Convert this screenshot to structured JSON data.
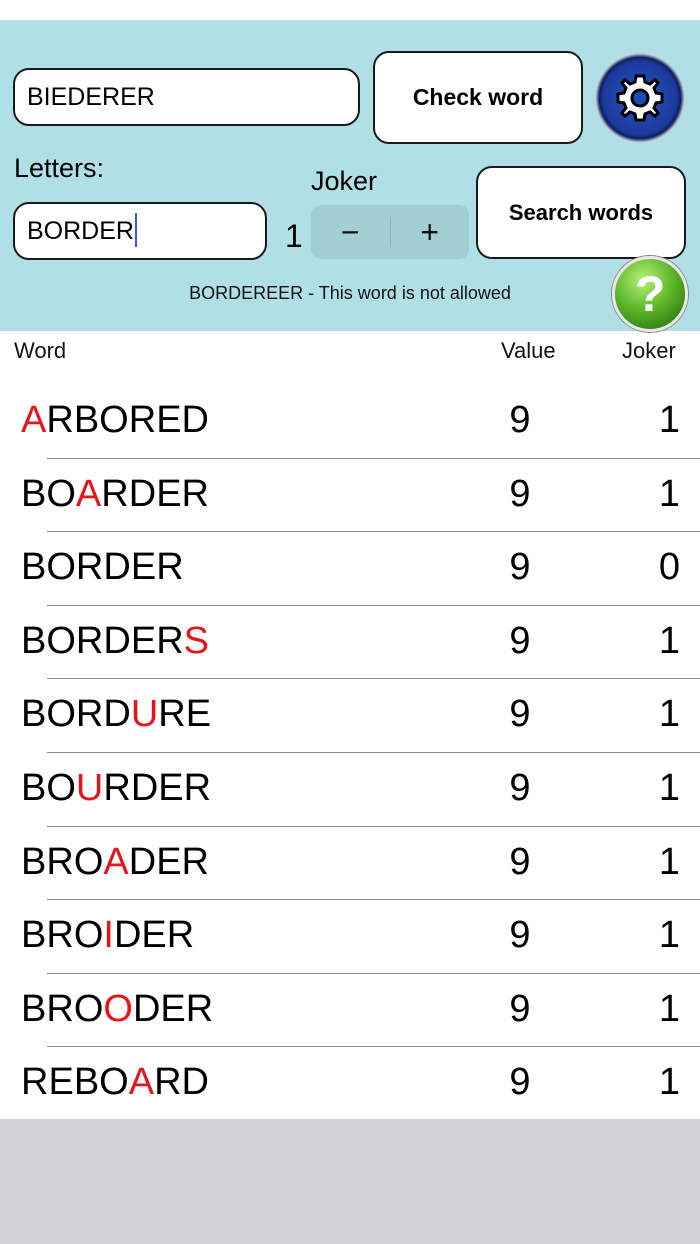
{
  "form": {
    "word_value": "BIEDERER",
    "check_label": "Check word",
    "letters_label": "Letters:",
    "letters_value": "BORDER",
    "joker_label": "Joker",
    "joker_count": "1",
    "minus": "−",
    "plus": "+",
    "search_label": "Search words",
    "status": "BORDEREER - This word is not allowed",
    "help": "?"
  },
  "table": {
    "headers": {
      "word": "Word",
      "value": "Value",
      "joker": "Joker"
    },
    "highlight_color": "#e8141b",
    "rows": [
      {
        "word": "ARBORED",
        "hl": [
          0
        ],
        "value": "9",
        "joker": "1"
      },
      {
        "word": "BOARDER",
        "hl": [
          2
        ],
        "value": "9",
        "joker": "1"
      },
      {
        "word": "BORDER",
        "hl": [],
        "value": "9",
        "joker": "0"
      },
      {
        "word": "BORDERS",
        "hl": [
          6
        ],
        "value": "9",
        "joker": "1"
      },
      {
        "word": "BORDURE",
        "hl": [
          4
        ],
        "value": "9",
        "joker": "1"
      },
      {
        "word": "BOURDER",
        "hl": [
          2
        ],
        "value": "9",
        "joker": "1"
      },
      {
        "word": "BROADER",
        "hl": [
          3
        ],
        "value": "9",
        "joker": "1"
      },
      {
        "word": "BROIDER",
        "hl": [
          3
        ],
        "value": "9",
        "joker": "1"
      },
      {
        "word": "BROODER",
        "hl": [
          3
        ],
        "value": "9",
        "joker": "1"
      },
      {
        "word": "REBOARD",
        "hl": [
          4
        ],
        "value": "9",
        "joker": "1"
      }
    ]
  },
  "icons": {
    "settings": "gear-icon",
    "help": "help-icon"
  },
  "colors": {
    "panel": "#b0e0e6",
    "footer": "#d1d1d6"
  }
}
